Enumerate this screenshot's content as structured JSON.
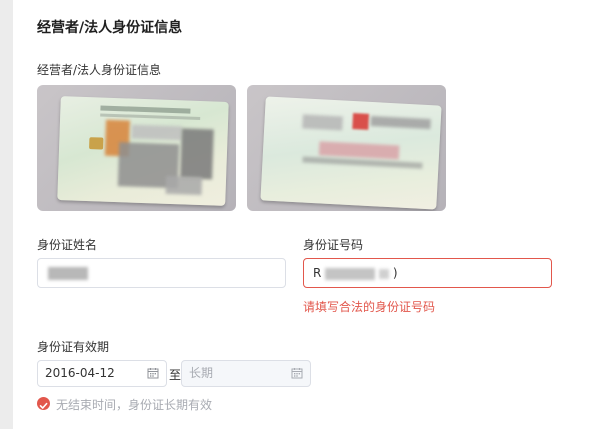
{
  "section": {
    "title": "经营者/法人身份证信息",
    "upload_label": "经营者/法人身份证信息"
  },
  "id_name": {
    "label": "身份证姓名",
    "value": ""
  },
  "id_number": {
    "label": "身份证号码",
    "value": "R",
    "value_suffix": ")",
    "error": "请填写合法的身份证号码"
  },
  "validity": {
    "label": "身份证有效期",
    "start_date": "2016-04-12",
    "separator": "至",
    "end_placeholder": "长期",
    "long_term_checked": true,
    "long_term_label": "无结束时间，身份证长期有效"
  },
  "colors": {
    "error": "#e2574c",
    "border": "#dcdfe6",
    "muted": "#a8abb2"
  },
  "icons": {
    "date_start": "calendar-icon",
    "date_end": "calendar-icon",
    "checkbox": "check-icon"
  }
}
